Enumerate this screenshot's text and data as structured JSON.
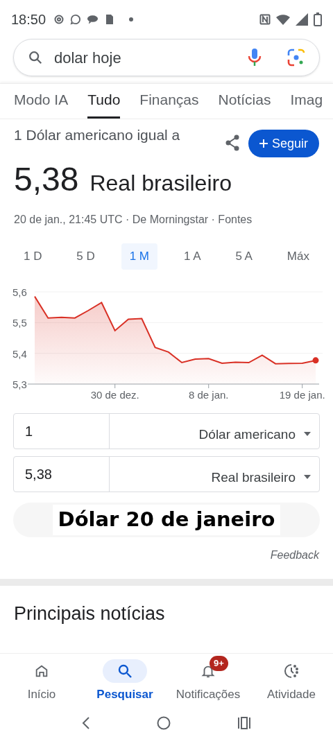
{
  "status_bar": {
    "time": "18:50"
  },
  "search": {
    "value": "dolar hoje"
  },
  "tabs": [
    {
      "label": "Modo IA",
      "selected": false
    },
    {
      "label": "Tudo",
      "selected": true
    },
    {
      "label": "Finanças",
      "selected": false
    },
    {
      "label": "Notícias",
      "selected": false
    },
    {
      "label": "Imag",
      "selected": false
    }
  ],
  "card": {
    "title": "1 Dólar americano igual a",
    "follow_button": "Seguir",
    "rate": "5,38",
    "currency": "Real brasileiro",
    "source": "20 de jan., 21:45 UTC · De Morningstar · Fontes"
  },
  "ranges": [
    {
      "label": "1 D",
      "selected": false
    },
    {
      "label": "5 D",
      "selected": false
    },
    {
      "label": "1 M",
      "selected": true
    },
    {
      "label": "1 A",
      "selected": false
    },
    {
      "label": "5 A",
      "selected": false
    },
    {
      "label": "Máx",
      "selected": false
    }
  ],
  "chart_data": {
    "type": "area",
    "categories": [
      null,
      null,
      null,
      null,
      null,
      null,
      "30 de dez.",
      null,
      null,
      null,
      null,
      null,
      null,
      "8 de jan.",
      null,
      null,
      null,
      null,
      null,
      null,
      "19 de jan.",
      null
    ],
    "series": [
      {
        "color": "#d93025",
        "values": [
          5.585,
          5.515,
          5.517,
          5.515,
          5.539,
          5.565,
          5.474,
          5.511,
          5.513,
          5.419,
          5.404,
          5.37,
          5.381,
          5.383,
          5.368,
          5.371,
          5.37,
          5.394,
          5.366,
          5.367,
          5.368,
          5.377
        ]
      }
    ],
    "ylim": [
      5.3,
      5.6
    ],
    "yticks": [
      {
        "value": 5.3,
        "label": "5,3"
      },
      {
        "value": 5.4,
        "label": "5,4"
      },
      {
        "value": 5.5,
        "label": "5,5"
      },
      {
        "value": 5.6,
        "label": "5,6"
      }
    ]
  },
  "converter": [
    {
      "value": "1",
      "currency": "Dólar americano"
    },
    {
      "value": "5,38",
      "currency": "Real brasileiro"
    }
  ],
  "caption": "Dólar 20 de janeiro",
  "feedback": "Feedback",
  "news_heading": "Principais notícias",
  "bottom_nav": [
    {
      "kind": "home",
      "label": "Início",
      "selected": false
    },
    {
      "kind": "search",
      "label": "Pesquisar",
      "selected": true
    },
    {
      "kind": "bell",
      "label": "Notificações",
      "selected": false,
      "badge": "9+"
    },
    {
      "kind": "activity",
      "label": "Atividade",
      "selected": false
    }
  ]
}
